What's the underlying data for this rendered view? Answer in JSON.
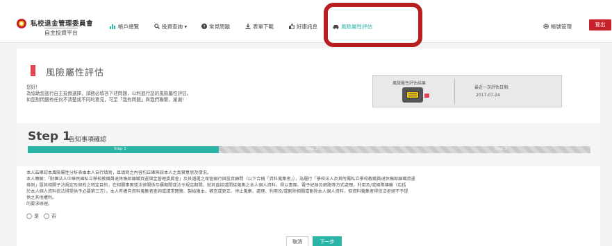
{
  "brand": {
    "title": "私校退金管理委員會",
    "subtitle": "自主投資平台"
  },
  "nav": [
    {
      "label": "帳戶總覽",
      "icon": "bar-chart-icon"
    },
    {
      "label": "投資查詢 ▾",
      "icon": "search-icon"
    },
    {
      "label": "常見問題",
      "icon": "question-icon"
    },
    {
      "label": "表單下載",
      "icon": "download-icon"
    },
    {
      "label": "好康訊息",
      "icon": "thumbs-up-icon"
    },
    {
      "label": "風險屬性評估",
      "icon": "car-icon"
    }
  ],
  "settings": {
    "label": "帳號管理",
    "icon": "gear-icon"
  },
  "logout": {
    "label": "登出"
  },
  "colors": {
    "accent": "#2bb5a6",
    "brand_red": "#c8202a",
    "highlight": "#b61e1f"
  },
  "page": {
    "title": "風險屬性評估",
    "intro": [
      "您好！",
      "為協助您進行自主投資選擇，請務必填答下述問題，以利進行您的風險屬性評估。",
      "如您對問題有任何不清楚或不同的意見，可至「我有問題」與我們聯繫，謝謝！"
    ]
  },
  "result": {
    "label": "風險屬性評估結果",
    "date_label": "最近一次評估日期:",
    "date_value": "2017-07-24"
  },
  "step": {
    "number": "Step 1",
    "name": "告知事項確認",
    "progress_fraction": 0.34,
    "labels": [
      "Step 1",
      "Step 2",
      "Step 3"
    ]
  },
  "disclosure": [
    "本人茲確認本風險屬性分析表由本人自行填寫，且填寫之內容均正確無誤本人之真實意思及情況。",
    "本人瞭解：「財團法人中華民國私立學校教職員退休撫卹離職資遣儲金管理委員會」及其遴選之保管銀行與投資顧問（以下合稱「資料蒐集者」），為履行「學校法人及其所屬私立學校教職員退休撫卹離職資遣",
    "條例」暨其相關子法規定及契約之特定目的，在相關事實或法律關係存續期間或法令規定期間，就其直接或間接蒐集之本人個人資料，得以書面、電子紀錄及網路等方式處理，利用及/或國際傳輸（包括",
    "於本人個人資料依法得提供予必要第三方）。本人有權向資料蒐集者查詢或請求閱覽、製給複本、補充或更正、停止蒐集、處理、利用及/或刪除相關或刪除本人個人資料，但資料蒐集者得依法拒絕不予提",
    "供之其他權利。",
    "的要求辦理。"
  ],
  "consent": {
    "yes": "是",
    "no": "否"
  },
  "buttons": {
    "cancel": "取消",
    "next": "下一步"
  }
}
